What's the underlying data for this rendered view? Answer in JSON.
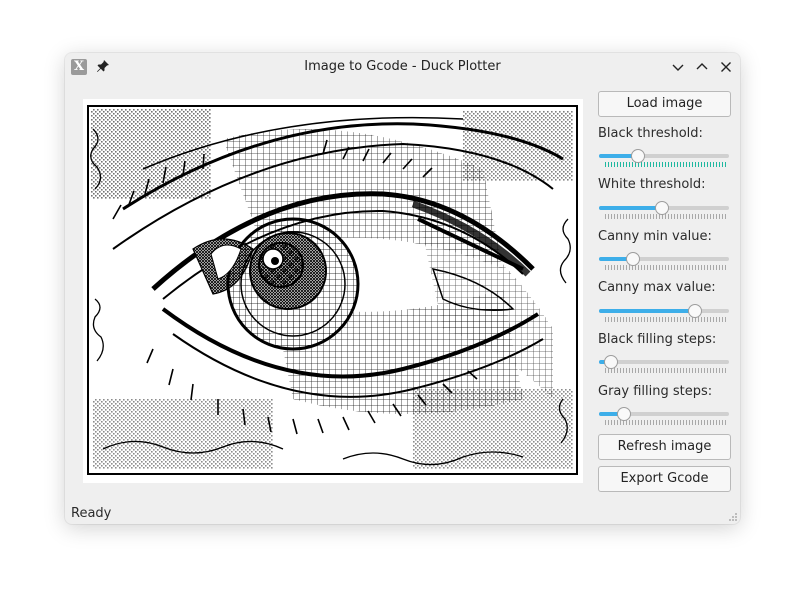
{
  "window": {
    "title": "Image to Gcode - Duck Plotter",
    "app_icon": "x-logo-icon",
    "pin_icon": "pin-icon",
    "buttons": [
      "chevron-down-icon",
      "chevron-up-icon",
      "close-icon"
    ]
  },
  "colors": {
    "accent": "#3daee9",
    "window_bg": "#efefef",
    "ticks_teal": "#1fb8a0"
  },
  "preview": {
    "description_icon": "image-preview"
  },
  "panel": {
    "load_label": "Load image",
    "refresh_label": "Refresh image",
    "export_label": "Export Gcode",
    "sliders": [
      {
        "label": "Black threshold:",
        "value": 0.27
      },
      {
        "label": "White threshold:",
        "value": 0.48
      },
      {
        "label": "Canny min value:",
        "value": 0.23
      },
      {
        "label": "Canny max value:",
        "value": 0.76
      },
      {
        "label": "Black filling steps:",
        "value": 0.04
      },
      {
        "label": "Gray filling steps:",
        "value": 0.15
      }
    ]
  },
  "status": {
    "text": "Ready"
  }
}
